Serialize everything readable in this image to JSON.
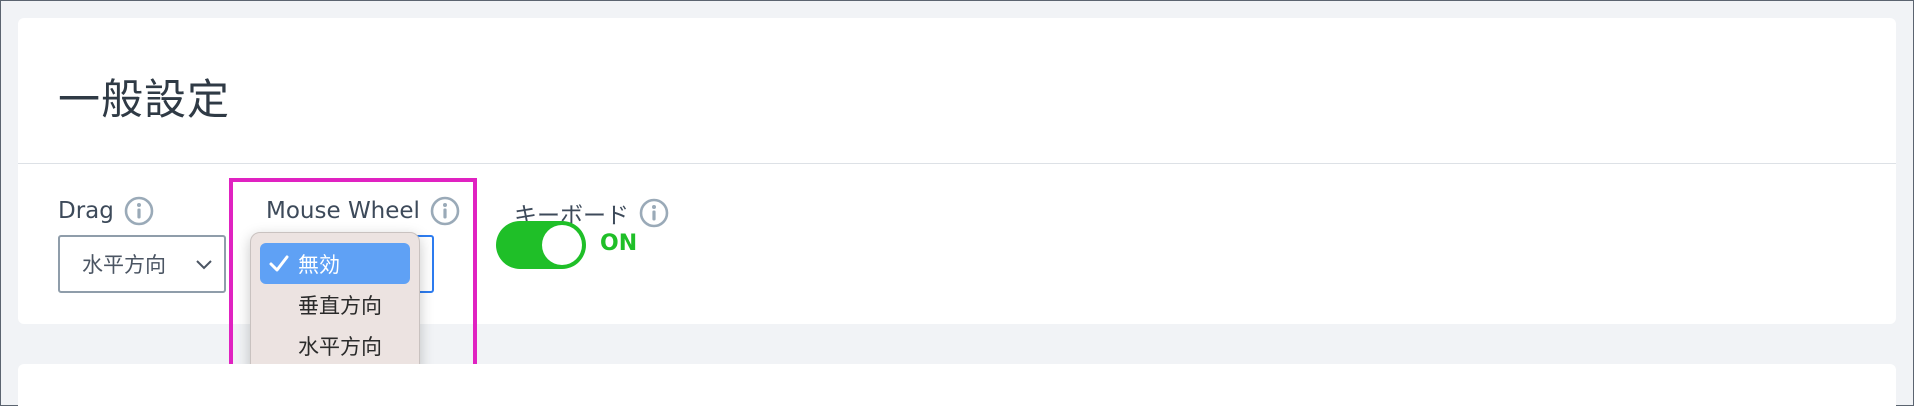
{
  "section": {
    "title": "一般設定"
  },
  "fields": {
    "drag": {
      "label": "Drag",
      "value": "水平方向"
    },
    "mouse_wheel": {
      "label": "Mouse Wheel",
      "options": [
        "無効",
        "垂直方向",
        "水平方向"
      ],
      "selected": "無効"
    },
    "keyboard": {
      "label": "キーボード",
      "state": "ON",
      "enabled": true
    }
  },
  "colors": {
    "toggle_on": "#1fbf28",
    "highlight": "#e022c1",
    "selected_option": "#5fa1f5",
    "info_icon": "#9aaab8"
  },
  "icons": {
    "info": "info-circle-icon",
    "chevron": "chevron-down-icon",
    "check": "checkmark-icon"
  }
}
